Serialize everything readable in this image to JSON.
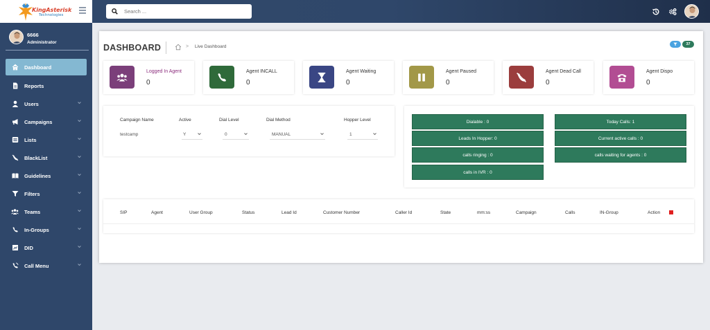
{
  "brand": {
    "line1": "KingAsterisk",
    "line2": "Technologies"
  },
  "search": {
    "placeholder": "Search ..."
  },
  "user": {
    "name": "6666",
    "role": "Administrator"
  },
  "sidebar": {
    "items": [
      {
        "label": "Dashboard",
        "icon": "home-icon",
        "active": true,
        "dropdown": false
      },
      {
        "label": "Reports",
        "icon": "file-icon",
        "active": false,
        "dropdown": false
      },
      {
        "label": "Users",
        "icon": "user-icon",
        "active": false,
        "dropdown": true
      },
      {
        "label": "Campaigns",
        "icon": "bullhorn-icon",
        "active": false,
        "dropdown": true
      },
      {
        "label": "Lists",
        "icon": "list-icon",
        "active": false,
        "dropdown": true
      },
      {
        "label": "BlackList",
        "icon": "phone-slash-icon",
        "active": false,
        "dropdown": true
      },
      {
        "label": "Guidelines",
        "icon": "book-icon",
        "active": false,
        "dropdown": true
      },
      {
        "label": "Filters",
        "icon": "filter-icon",
        "active": false,
        "dropdown": true
      },
      {
        "label": "Teams",
        "icon": "users-icon",
        "active": false,
        "dropdown": true
      },
      {
        "label": "In-Groups",
        "icon": "phone-icon",
        "active": false,
        "dropdown": true
      },
      {
        "label": "DID",
        "icon": "did-icon",
        "active": false,
        "dropdown": true
      },
      {
        "label": "Call Menu",
        "icon": "call-menu-icon",
        "active": false,
        "dropdown": true
      }
    ]
  },
  "page": {
    "title": "DASHBOARD",
    "breadcrumb_current": "Live Dashboard",
    "filter_count": "37"
  },
  "cards": [
    {
      "label": "Logged In Agent",
      "value": "0",
      "color": "#7b3f7a",
      "icon": "users-icon"
    },
    {
      "label": "Agent INCALL",
      "value": "0",
      "color": "#2f6a3a",
      "icon": "phone-icon"
    },
    {
      "label": "Agent Waiting",
      "value": "0",
      "color": "#3a4684",
      "icon": "hourglass-icon"
    },
    {
      "label": "Agent Paused",
      "value": "0",
      "color": "#a29848",
      "icon": "pause-icon"
    },
    {
      "label": "Agent Dead Call",
      "value": "0",
      "color": "#9b3d3d",
      "icon": "phone-slash-icon"
    },
    {
      "label": "Agent Dispo",
      "value": "0",
      "color": "#b24d93",
      "icon": "telephone-icon"
    }
  ],
  "campaign_table": {
    "headers": [
      "Campaign Name",
      "Active",
      "Dial Level",
      "Dial Method",
      "Hopper Level"
    ],
    "row": {
      "name": "testcamp",
      "active": "Y",
      "dial_level": "0",
      "dial_method": "MANUAL",
      "hopper_level": "1"
    }
  },
  "stats": {
    "dialable": "Dialable : 0",
    "leads_in_hopper": "Leads In Hopper: 0",
    "calls_ringing": "calls ringing : 0",
    "calls_in_ivr": "calls in IVR : 0",
    "today_calls": "Today Calls: 1",
    "current_active_calls": "Current active calls : 0",
    "calls_waiting": "calls waiting for agents : 0"
  },
  "live_table": {
    "headers": [
      "SIP",
      "Agent",
      "User Group",
      "Status",
      "Lead Id",
      "Customer Number",
      "Caller Id",
      "State",
      "mm:ss",
      "Campaign",
      "Calls",
      "IN-Group",
      "Action"
    ]
  }
}
